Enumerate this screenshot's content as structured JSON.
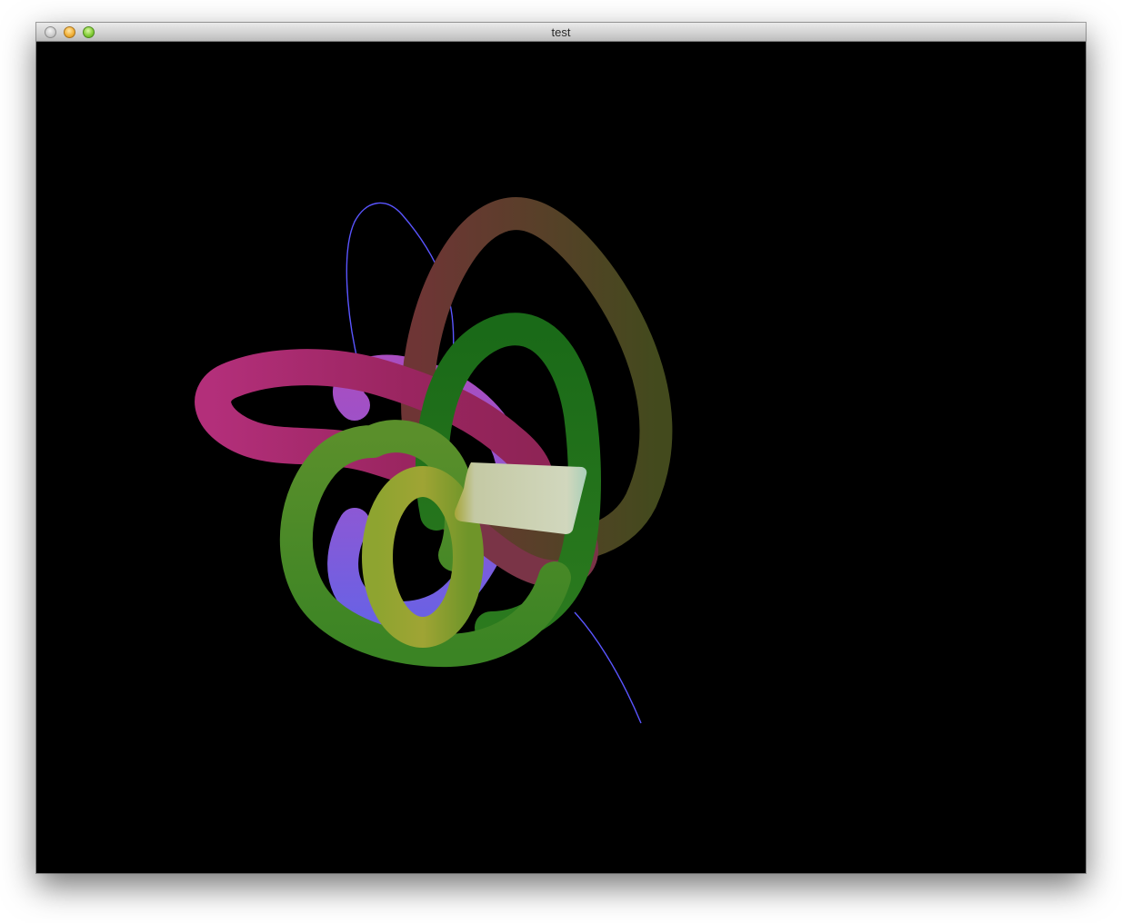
{
  "window": {
    "title": "test",
    "controls": {
      "close": "close-button",
      "minimize": "minimize-button",
      "zoom": "zoom-button"
    }
  },
  "scene": {
    "background": "#000000",
    "tube_colors": {
      "magenta": "#b5307c",
      "purple": "#a34bc6",
      "blue": "#6b5fe0",
      "brown": "#6b3a35",
      "olive": "#4f5120",
      "dark_green": "#1f6b1c",
      "light_green": "#4f8f27",
      "yellow_green": "#a3a534",
      "pale_ribbon": "#c8ceb4",
      "thin_line": "#5a55ff"
    }
  }
}
